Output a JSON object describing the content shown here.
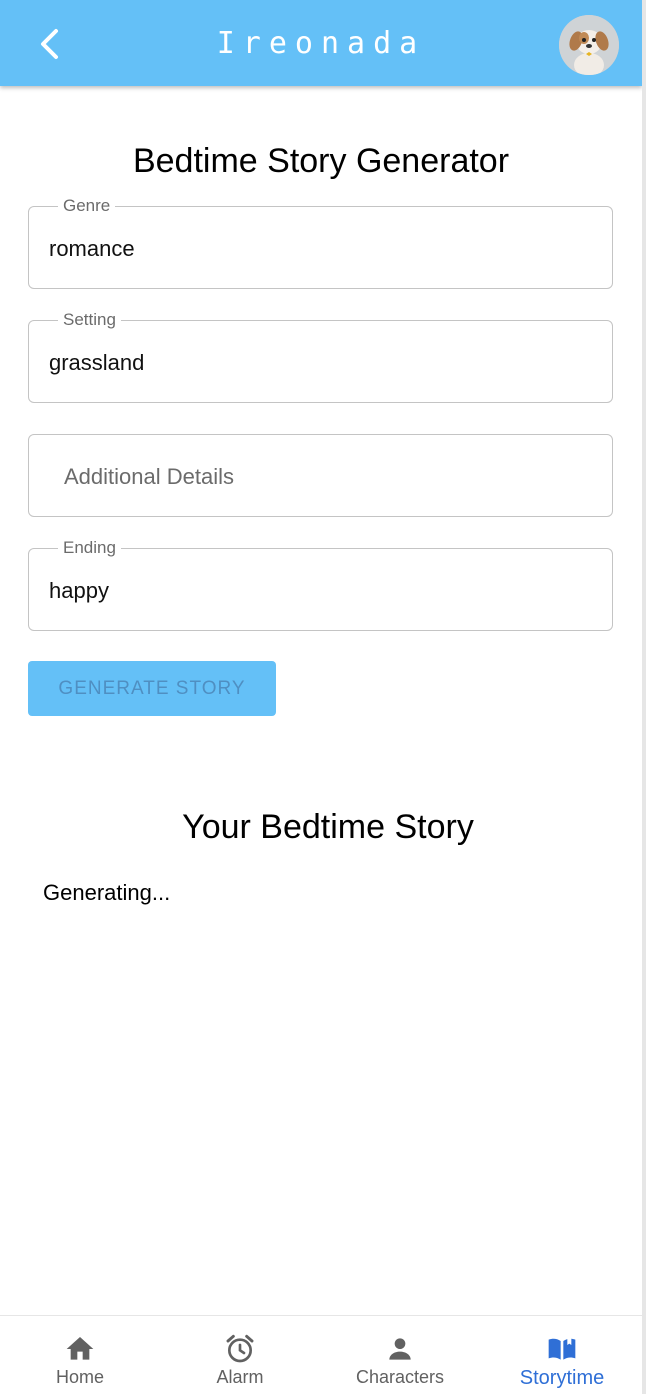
{
  "header": {
    "title": "Ireonada",
    "back_icon": "chevron-left-icon",
    "avatar_icon": "puppy-avatar",
    "color": "#64c0f7"
  },
  "form": {
    "title": "Bedtime Story Generator",
    "genre": {
      "label": "Genre",
      "value": "romance"
    },
    "setting": {
      "label": "Setting",
      "value": "grassland"
    },
    "details": {
      "placeholder": "Additional Details",
      "value": ""
    },
    "ending": {
      "label": "Ending",
      "value": "happy"
    },
    "generate_label": "GENERATE STORY"
  },
  "story": {
    "title": "Your Bedtime Story",
    "status": "Generating..."
  },
  "nav": {
    "active_color": "#2f6fd6",
    "items": [
      {
        "label": "Home",
        "icon": "home-icon"
      },
      {
        "label": "Alarm",
        "icon": "alarm-clock-icon"
      },
      {
        "label": "Characters",
        "icon": "person-icon"
      },
      {
        "label": "Storytime",
        "icon": "open-book-icon"
      }
    ]
  }
}
